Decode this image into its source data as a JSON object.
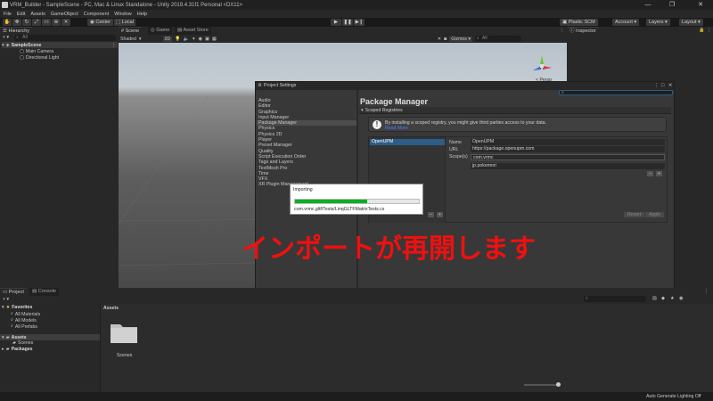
{
  "window": {
    "title": "VRM_Builder - SampleScene - PC, Mac & Linux Standalone - Unity 2019.4.31f1 Personal <DX11>",
    "minimize": "—",
    "maximize": "❐",
    "close": "✕"
  },
  "menu": [
    "File",
    "Edit",
    "Assets",
    "GameObject",
    "Component",
    "Window",
    "Help"
  ],
  "toolbar": {
    "center_label": "Center",
    "local_label": "Local",
    "plastic_label": "Plastic SCM",
    "account_label": "Account",
    "layers_label": "Layers",
    "layout_label": "Layout"
  },
  "hierarchy": {
    "tab": "Hierarchy",
    "search_placeholder": "All",
    "scene": "SampleScene",
    "objects": [
      "Main Camera",
      "Directional Light"
    ]
  },
  "scene": {
    "tabs": [
      "Scene",
      "Game",
      "Asset Store"
    ],
    "shading": "Shaded",
    "mode_2d": "2D",
    "gizmos": "Gizmos",
    "search_placeholder": "All",
    "persp": "< Persp"
  },
  "inspector": {
    "tab": "Inspector"
  },
  "project_settings": {
    "title": "Project Settings",
    "search_value": "",
    "categories": [
      "Audio",
      "Editor",
      "Graphics",
      "Input Manager",
      "Package Manager",
      "Physics",
      "Physics 2D",
      "Player",
      "Preset Manager",
      "Quality",
      "Script Execution Order",
      "Tags and Layers",
      "TextMesh Pro",
      "Time",
      "VFX",
      "XR Plugin Management"
    ],
    "selected_index": 4,
    "heading": "Package Manager",
    "section": "Scoped Registries",
    "info": "By installing a scoped registry, you might give third parties access to your data.",
    "read_more": "Read More",
    "registries": [
      "OpenUPM"
    ],
    "fields": {
      "name_label": "Name",
      "name_value": "OpenUPM",
      "url_label": "URL",
      "url_value": "https://package.openupm.com",
      "scope_label": "Scope(s)",
      "scope1": "com.vrmc",
      "scope2": "jp.pokemori"
    },
    "revert": "Revert",
    "apply": "Apply"
  },
  "import": {
    "title": "Importing",
    "progress": 0.58,
    "file": "com.vrmc.gltf/Tests/LinqGLTFMatrixTests.cs"
  },
  "project": {
    "tabs": [
      "Project",
      "Console"
    ],
    "favorites_label": "Favorites",
    "favorites": [
      "All Materials",
      "All Models",
      "All Prefabs"
    ],
    "assets_label": "Assets",
    "assets_children": [
      "Scenes"
    ],
    "packages_label": "Packages",
    "breadcrumb": "Assets",
    "folder_name": "Scenes",
    "search_placeholder": ""
  },
  "status": {
    "text": "Auto Generate Lighting Off"
  },
  "overlay": {
    "text": "インポートが再開します"
  },
  "colors": {
    "overlay_red": "#f01010",
    "progress_green": "#06b025",
    "accent_blue": "#2c5d87"
  }
}
